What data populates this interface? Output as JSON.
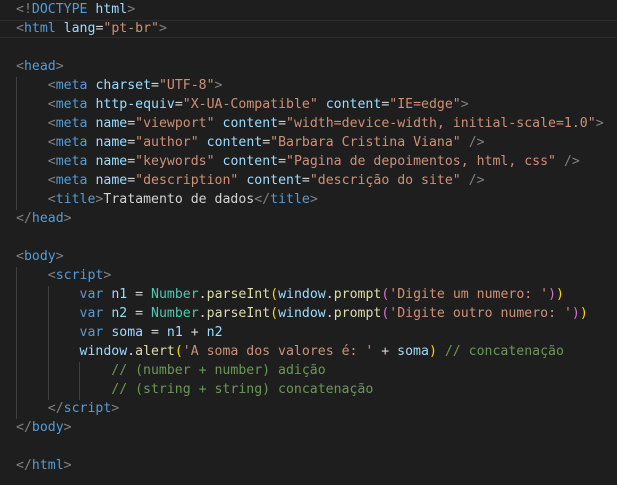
{
  "editor": {
    "background": "#1e1e1e",
    "cursor_line": 2,
    "lines": [
      [
        [
          "t-punct",
          "<!"
        ],
        [
          "t-tag",
          "DOCTYPE"
        ],
        [
          "t-text",
          " "
        ],
        [
          "t-attr",
          "html"
        ],
        [
          "t-punct",
          ">"
        ]
      ],
      [
        [
          "t-punct",
          "<"
        ],
        [
          "t-tag",
          "html"
        ],
        [
          "t-text",
          " "
        ],
        [
          "t-attr",
          "lang"
        ],
        [
          "t-text",
          "="
        ],
        [
          "t-str",
          "\"pt-br\""
        ],
        [
          "t-punct",
          ">"
        ]
      ],
      [],
      [
        [
          "t-punct",
          "<"
        ],
        [
          "t-tag",
          "head"
        ],
        [
          "t-punct",
          ">"
        ]
      ],
      [
        [
          "t-text",
          "    "
        ],
        [
          "t-punct",
          "<"
        ],
        [
          "t-tag",
          "meta"
        ],
        [
          "t-text",
          " "
        ],
        [
          "t-attr",
          "charset"
        ],
        [
          "t-text",
          "="
        ],
        [
          "t-str",
          "\"UTF-8\""
        ],
        [
          "t-punct",
          ">"
        ]
      ],
      [
        [
          "t-text",
          "    "
        ],
        [
          "t-punct",
          "<"
        ],
        [
          "t-tag",
          "meta"
        ],
        [
          "t-text",
          " "
        ],
        [
          "t-attr",
          "http-equiv"
        ],
        [
          "t-text",
          "="
        ],
        [
          "t-str",
          "\"X-UA-Compatible\""
        ],
        [
          "t-text",
          " "
        ],
        [
          "t-attr",
          "content"
        ],
        [
          "t-text",
          "="
        ],
        [
          "t-str",
          "\"IE=edge\""
        ],
        [
          "t-punct",
          ">"
        ]
      ],
      [
        [
          "t-text",
          "    "
        ],
        [
          "t-punct",
          "<"
        ],
        [
          "t-tag",
          "meta"
        ],
        [
          "t-text",
          " "
        ],
        [
          "t-attr",
          "name"
        ],
        [
          "t-text",
          "="
        ],
        [
          "t-str",
          "\"viewport\""
        ],
        [
          "t-text",
          " "
        ],
        [
          "t-attr",
          "content"
        ],
        [
          "t-text",
          "="
        ],
        [
          "t-str",
          "\"width=device-width, initial-scale=1.0\""
        ],
        [
          "t-punct",
          ">"
        ]
      ],
      [
        [
          "t-text",
          "    "
        ],
        [
          "t-punct",
          "<"
        ],
        [
          "t-tag",
          "meta"
        ],
        [
          "t-text",
          " "
        ],
        [
          "t-attr",
          "name"
        ],
        [
          "t-text",
          "="
        ],
        [
          "t-str",
          "\"author\""
        ],
        [
          "t-text",
          " "
        ],
        [
          "t-attr",
          "content"
        ],
        [
          "t-text",
          "="
        ],
        [
          "t-str",
          "\"Barbara Cristina Viana\""
        ],
        [
          "t-text",
          " "
        ],
        [
          "t-punct",
          "/>"
        ]
      ],
      [
        [
          "t-text",
          "    "
        ],
        [
          "t-punct",
          "<"
        ],
        [
          "t-tag",
          "meta"
        ],
        [
          "t-text",
          " "
        ],
        [
          "t-attr",
          "name"
        ],
        [
          "t-text",
          "="
        ],
        [
          "t-str",
          "\"keywords\""
        ],
        [
          "t-text",
          " "
        ],
        [
          "t-attr",
          "content"
        ],
        [
          "t-text",
          "="
        ],
        [
          "t-str",
          "\"Pagina de depoimentos, html, css\""
        ],
        [
          "t-text",
          " "
        ],
        [
          "t-punct",
          "/>"
        ]
      ],
      [
        [
          "t-text",
          "    "
        ],
        [
          "t-punct",
          "<"
        ],
        [
          "t-tag",
          "meta"
        ],
        [
          "t-text",
          " "
        ],
        [
          "t-attr",
          "name"
        ],
        [
          "t-text",
          "="
        ],
        [
          "t-str",
          "\"description\""
        ],
        [
          "t-text",
          " "
        ],
        [
          "t-attr",
          "content"
        ],
        [
          "t-text",
          "="
        ],
        [
          "t-str",
          "\"descrição do site\""
        ],
        [
          "t-text",
          " "
        ],
        [
          "t-punct",
          "/>"
        ]
      ],
      [
        [
          "t-text",
          "    "
        ],
        [
          "t-punct",
          "<"
        ],
        [
          "t-tag",
          "title"
        ],
        [
          "t-punct",
          ">"
        ],
        [
          "t-text",
          "Tratamento de dados"
        ],
        [
          "t-punct",
          "</"
        ],
        [
          "t-tag",
          "title"
        ],
        [
          "t-punct",
          ">"
        ]
      ],
      [
        [
          "t-punct",
          "</"
        ],
        [
          "t-tag",
          "head"
        ],
        [
          "t-punct",
          ">"
        ]
      ],
      [],
      [
        [
          "t-punct",
          "<"
        ],
        [
          "t-tag",
          "body"
        ],
        [
          "t-punct",
          ">"
        ]
      ],
      [
        [
          "t-text",
          "    "
        ],
        [
          "t-punct",
          "<"
        ],
        [
          "t-tag",
          "script"
        ],
        [
          "t-punct",
          ">"
        ]
      ],
      [
        [
          "t-text",
          "        "
        ],
        [
          "t-kw",
          "var"
        ],
        [
          "t-text",
          " "
        ],
        [
          "t-var",
          "n1"
        ],
        [
          "t-op",
          " = "
        ],
        [
          "t-cls",
          "Number"
        ],
        [
          "t-op",
          "."
        ],
        [
          "t-fn",
          "parseInt"
        ],
        [
          "t-p1",
          "("
        ],
        [
          "t-var",
          "window"
        ],
        [
          "t-op",
          "."
        ],
        [
          "t-fn",
          "prompt"
        ],
        [
          "t-p2",
          "("
        ],
        [
          "t-str",
          "'Digite um numero: '"
        ],
        [
          "t-p2",
          ")"
        ],
        [
          "t-p1",
          ")"
        ]
      ],
      [
        [
          "t-text",
          "        "
        ],
        [
          "t-kw",
          "var"
        ],
        [
          "t-text",
          " "
        ],
        [
          "t-var",
          "n2"
        ],
        [
          "t-op",
          " = "
        ],
        [
          "t-cls",
          "Number"
        ],
        [
          "t-op",
          "."
        ],
        [
          "t-fn",
          "parseInt"
        ],
        [
          "t-p1",
          "("
        ],
        [
          "t-var",
          "window"
        ],
        [
          "t-op",
          "."
        ],
        [
          "t-fn",
          "prompt"
        ],
        [
          "t-p2",
          "("
        ],
        [
          "t-str",
          "'Digite outro numero: '"
        ],
        [
          "t-p2",
          ")"
        ],
        [
          "t-p1",
          ")"
        ]
      ],
      [
        [
          "t-text",
          "        "
        ],
        [
          "t-kw",
          "var"
        ],
        [
          "t-text",
          " "
        ],
        [
          "t-var",
          "soma"
        ],
        [
          "t-op",
          " = "
        ],
        [
          "t-var",
          "n1"
        ],
        [
          "t-op",
          " + "
        ],
        [
          "t-var",
          "n2"
        ]
      ],
      [
        [
          "t-text",
          "        "
        ],
        [
          "t-var",
          "window"
        ],
        [
          "t-op",
          "."
        ],
        [
          "t-fn",
          "alert"
        ],
        [
          "t-p1",
          "("
        ],
        [
          "t-str",
          "'A soma dos valores é: '"
        ],
        [
          "t-op",
          " + "
        ],
        [
          "t-var",
          "soma"
        ],
        [
          "t-p1",
          ")"
        ],
        [
          "t-text",
          " "
        ],
        [
          "t-com",
          "// concatenação"
        ]
      ],
      [
        [
          "t-text",
          "            "
        ],
        [
          "t-com",
          "// (number + number) adição"
        ]
      ],
      [
        [
          "t-text",
          "            "
        ],
        [
          "t-com",
          "// (string + string) concatenação"
        ]
      ],
      [
        [
          "t-text",
          "    "
        ],
        [
          "t-punct",
          "</"
        ],
        [
          "t-tag",
          "script"
        ],
        [
          "t-punct",
          ">"
        ]
      ],
      [
        [
          "t-punct",
          "</"
        ],
        [
          "t-tag",
          "body"
        ],
        [
          "t-punct",
          ">"
        ]
      ],
      [],
      [
        [
          "t-punct",
          "</"
        ],
        [
          "t-tag",
          "html"
        ],
        [
          "t-punct",
          ">"
        ]
      ]
    ]
  }
}
